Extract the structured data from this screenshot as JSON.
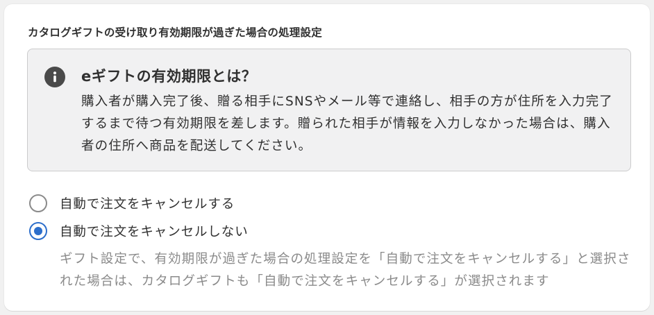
{
  "section": {
    "title": "カタログギフトの受け取り有効期限が過ぎた場合の処理設定"
  },
  "info": {
    "icon": "info-icon",
    "heading": "eギフトの有効期限とは？",
    "body": "購入者が購入完了後、贈る相手にSNSやメール等で連絡し、相手の方が住所を入力完了するまで待つ有効期限を差します。贈られた相手が情報を入力しなかった場合は、購入者の住所へ商品を配送してください。"
  },
  "options": [
    {
      "label": "自動で注文をキャンセルする",
      "checked": false
    },
    {
      "label": "自動で注文をキャンセルしない",
      "checked": true
    }
  ],
  "help_text": "ギフト設定で、有効期限が過ぎた場合の処理設定を「自動で注文をキャンセルする」と選択された場合は、カタログギフトも「自動で注文をキャンセルする」が選択されます",
  "colors": {
    "accent": "#2c6ecb",
    "info_bg": "#f1f1f2",
    "muted_text": "#8a8a8a"
  }
}
